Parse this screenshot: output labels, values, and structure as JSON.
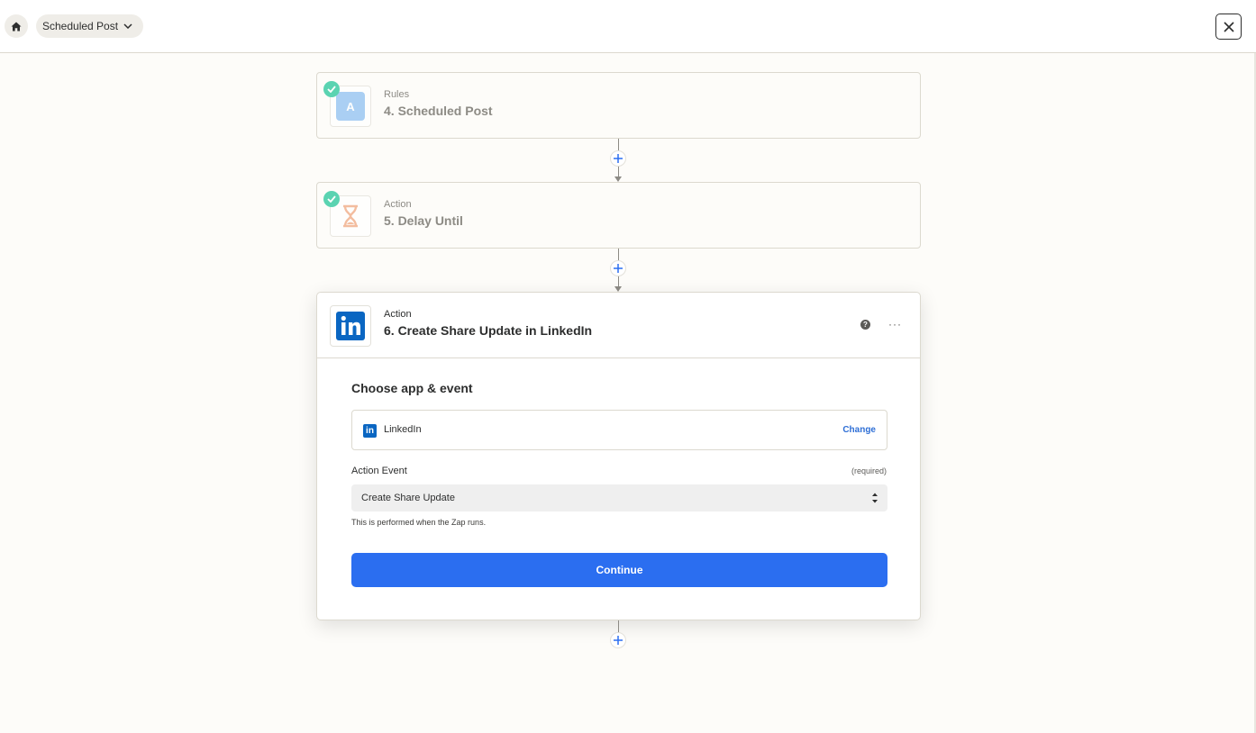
{
  "header": {
    "zap_name": "Scheduled Post",
    "home_icon": "home-icon",
    "chevron_icon": "chevron-down-icon",
    "close_icon": "close-icon"
  },
  "steps": [
    {
      "kind": "Rules",
      "title": "4. Scheduled Post",
      "badge": "A",
      "completed": true
    },
    {
      "kind": "Action",
      "title": "5. Delay Until",
      "icon": "hourglass-icon",
      "completed": true
    }
  ],
  "active_step": {
    "kind": "Action",
    "title": "6. Create Share Update in LinkedIn",
    "icon": "linkedin-icon",
    "help_label": "?",
    "more_label": "···",
    "section_title": "Choose app & event",
    "app": {
      "name": "LinkedIn",
      "change_label": "Change",
      "mini_logo": "in"
    },
    "event_field": {
      "label": "Action Event",
      "required_label": "(required)",
      "value": "Create Share Update",
      "hint": "This is performed when the Zap runs."
    },
    "continue_label": "Continue"
  },
  "colors": {
    "accent": "#2b6ef0",
    "linkedin": "#0a66c2",
    "success": "#5ad3b1",
    "delay": "#f0a982",
    "background": "#fdfcf9"
  }
}
